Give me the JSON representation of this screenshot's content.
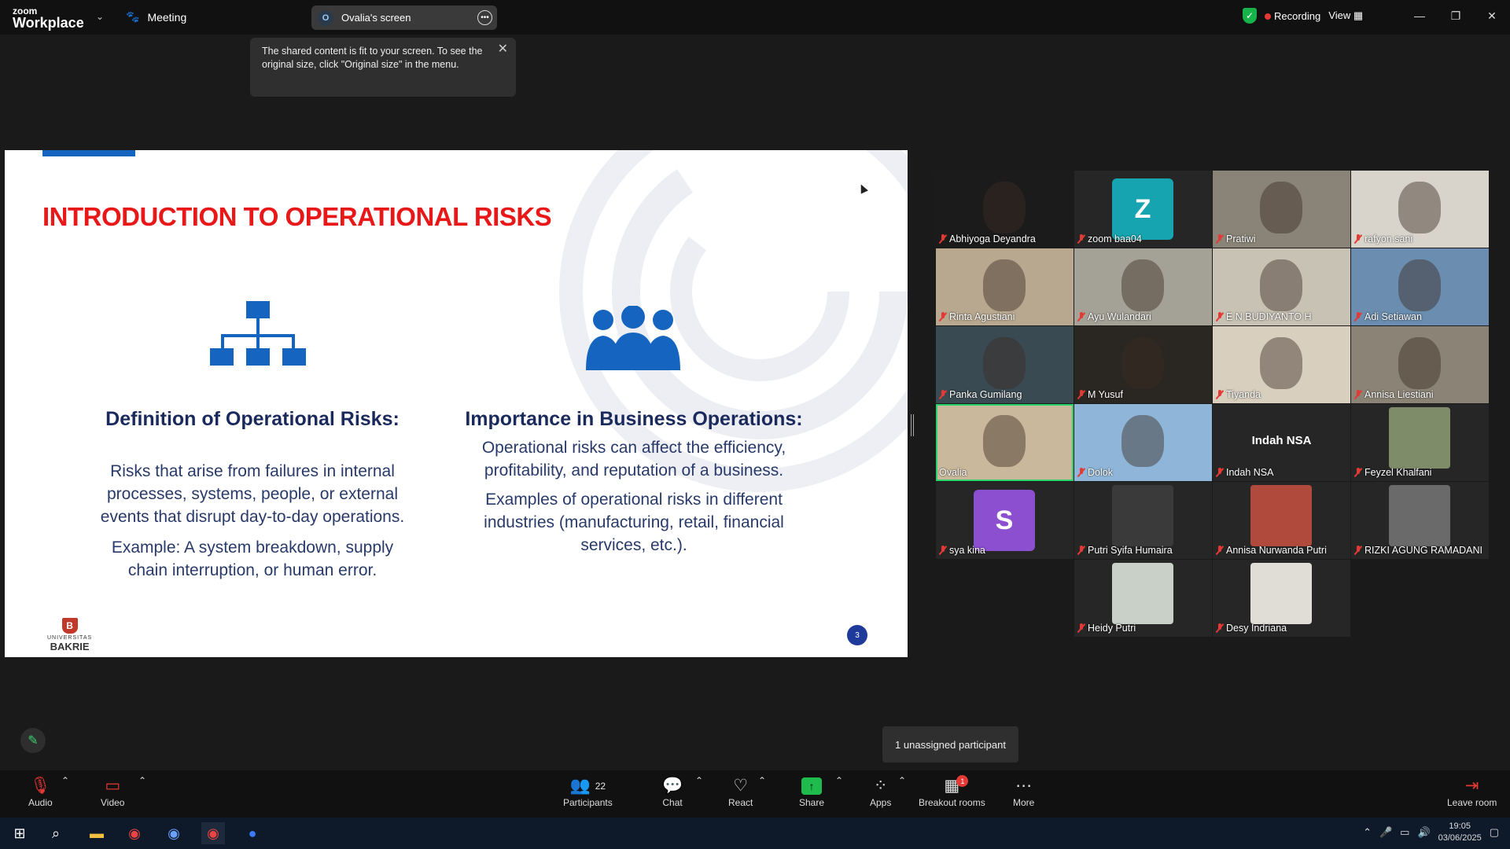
{
  "app": {
    "logo_small": "zoom",
    "logo_big": "Workplace",
    "meeting_label": "Meeting",
    "screen_owner_initial": "O",
    "screen_label": "Ovalia's screen",
    "recording_label": "Recording",
    "view_label": "View"
  },
  "notice": {
    "text": "The shared content is fit to your screen. To see the original size, click \"Original size\" in the menu."
  },
  "slide": {
    "title": "INTRODUCTION TO OPERATIONAL RISKS",
    "left_heading": "Definition of Operational Risks:",
    "left_body": "Risks that arise from failures in internal processes, systems, people, or external events that disrupt day-to-day operations.",
    "left_example": "Example: A system breakdown, supply chain interruption, or human error.",
    "right_heading": "Importance in Business Operations:",
    "right_body": "Operational risks can affect the efficiency, profitability, and reputation of a business.",
    "right_example": "Examples of operational risks in different industries (manufacturing, retail, financial services, etc.).",
    "logo_small": "UNIVERSITAS",
    "logo_big": "BAKRIE",
    "logo_letter": "B",
    "page_number": "3",
    "colors": {
      "title": "#e81818",
      "heading": "#1a2a5c",
      "icon": "#1565c0"
    }
  },
  "participants": [
    {
      "name": "Abhiyoga Deyandra",
      "muted": true,
      "style": "video",
      "color": "#1b1b1b"
    },
    {
      "name": "zoom baa04",
      "muted": true,
      "style": "letter",
      "letter": "Z",
      "color": "#16a5b0"
    },
    {
      "name": "Pratiwi",
      "muted": true,
      "style": "video",
      "color": "#8a8478"
    },
    {
      "name": "rafyon.sani",
      "muted": true,
      "style": "video",
      "color": "#d8d4cc"
    },
    {
      "name": "Rinta Agustiani",
      "muted": true,
      "style": "video",
      "color": "#b8a890"
    },
    {
      "name": "Ayu Wulandari",
      "muted": true,
      "style": "video",
      "color": "#a4a296"
    },
    {
      "name": "E N BUDIYANTO H",
      "muted": true,
      "style": "video",
      "color": "#c8c2b4"
    },
    {
      "name": "Adi Setiawan",
      "muted": true,
      "style": "video",
      "color": "#6a8db0"
    },
    {
      "name": "Panka Gumilang",
      "muted": true,
      "style": "video",
      "color": "#3a4a52"
    },
    {
      "name": "M Yusuf",
      "muted": true,
      "style": "video",
      "color": "#2a2622"
    },
    {
      "name": "Tiyanda",
      "muted": true,
      "style": "video",
      "color": "#d8cfbf"
    },
    {
      "name": "Annisa Liestiani",
      "muted": true,
      "style": "video",
      "color": "#8b8375"
    },
    {
      "name": "Ovalia",
      "muted": false,
      "style": "video",
      "color": "#c9b89c",
      "active": true
    },
    {
      "name": "Dolok",
      "muted": true,
      "style": "video",
      "color": "#8fb6d8"
    },
    {
      "name": "Indah NSA",
      "muted": true,
      "style": "name"
    },
    {
      "name": "Feyzel Khalfani",
      "muted": true,
      "style": "pic",
      "color": "#7e8c6a"
    },
    {
      "name": "sya kina",
      "muted": true,
      "style": "letter",
      "letter": "S",
      "color": "#8b4fd0"
    },
    {
      "name": "Putri Syifa Humaira",
      "muted": true,
      "style": "pic",
      "color": "#3a3a3a"
    },
    {
      "name": "Annisa Nurwanda Putri",
      "muted": true,
      "style": "pic",
      "color": "#b04a3c"
    },
    {
      "name": "RIZKI AGUNG RAMADANI",
      "muted": true,
      "style": "pic",
      "color": "#6a6a6a"
    },
    {
      "name": "Heidy Putri",
      "muted": true,
      "style": "pic",
      "color": "#c8d0c8"
    },
    {
      "name": "Desy Indriana",
      "muted": true,
      "style": "pic",
      "color": "#e0dcd6"
    }
  ],
  "unassigned_label": "1 unassigned participant",
  "toolbar": {
    "audio": "Audio",
    "video": "Video",
    "participants": "Participants",
    "participants_count": "22",
    "chat": "Chat",
    "react": "React",
    "share": "Share",
    "apps": "Apps",
    "breakout": "Breakout rooms",
    "breakout_badge": "1",
    "more": "More",
    "leave": "Leave room"
  },
  "taskbar": {
    "time": "19:05",
    "date": "03/06/2025"
  }
}
